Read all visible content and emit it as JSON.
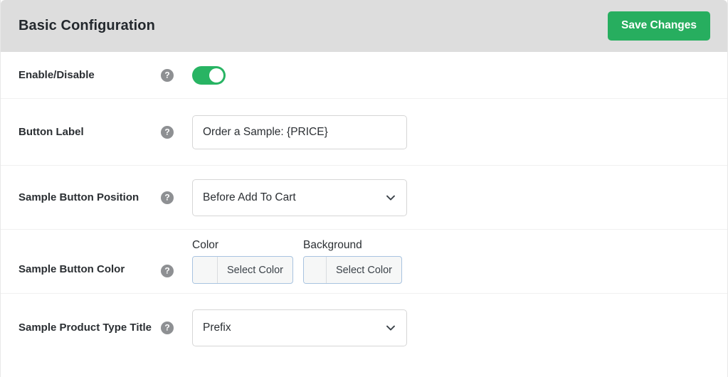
{
  "header": {
    "title": "Basic Configuration",
    "save_label": "Save Changes",
    "accent_color": "#27ae5f",
    "background_color": "#dddddd"
  },
  "help_icon_glyph": "?",
  "rows": {
    "enable_disable": {
      "label": "Enable/Disable",
      "toggle_state": "on",
      "toggle_color": "#28b463"
    },
    "button_label": {
      "label": "Button Label",
      "value": "Order a Sample: {PRICE}",
      "placeholder": "Order a Sample: {PRICE}"
    },
    "sample_button_position": {
      "label": "Sample Button Position",
      "selected": "Before Add To Cart"
    },
    "sample_button_color": {
      "label": "Sample Button Color",
      "color": {
        "caption": "Color",
        "button_label": "Select Color",
        "swatch": ""
      },
      "background": {
        "caption": "Background",
        "button_label": "Select Color",
        "swatch": ""
      }
    },
    "sample_product_type_title": {
      "label": "Sample Product Type Title",
      "selected": "Prefix"
    }
  }
}
